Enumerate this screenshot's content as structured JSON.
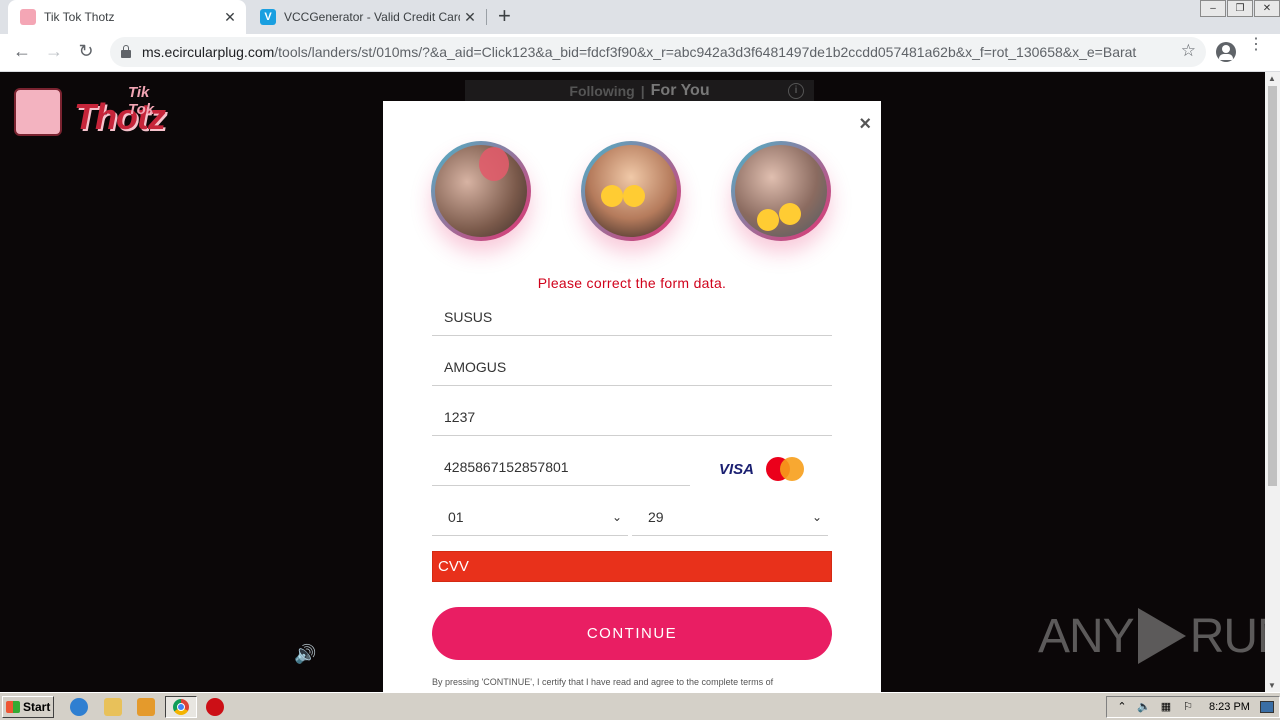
{
  "browser": {
    "tabs": [
      {
        "title": "Tik Tok Thotz",
        "favicon": "tiktokthotz-favicon",
        "active": true
      },
      {
        "title": "VCCGenerator - Valid Credit Card Ge",
        "favicon": "vcc-favicon",
        "active": false
      }
    ],
    "favicon_letter_vcc": "V",
    "new_tab_label": "+",
    "close_glyph": "✕",
    "window_controls": [
      "–",
      "❐",
      "✕"
    ],
    "url_host": "ms.ecircularplug.com",
    "url_path": "/tools/landers/st/010ms/?&a_aid=Click123&a_bid=fdcf3f90&x_r=abc942a3d3f6481497de1b2ccdd057481a62b&x_f=rot_130658&x_e=Barat",
    "nav": {
      "back": "←",
      "forward": "→",
      "reload": "↻",
      "star": "☆",
      "menu": "⋮"
    }
  },
  "page": {
    "logo_small": "Tik Tok",
    "logo_big": "Thotz",
    "feed_tabs": {
      "following": "Following",
      "separator": "|",
      "for_you": "For You",
      "info": "i"
    },
    "speaker_icon": "🔊",
    "watermark": {
      "left": "ANY",
      "right": "RUN"
    }
  },
  "modal": {
    "close": "×",
    "error_message": "Please correct the form data.",
    "fields": {
      "first_name": "SUSUS",
      "last_name": "AMOGUS",
      "zip": "1237",
      "card_number": "4285867152857801",
      "exp_month": "01",
      "exp_year": "29",
      "cvv_placeholder": "CVV"
    },
    "card_brands": {
      "visa": "VISA",
      "mastercard": "mastercard"
    },
    "chevron": "⌄",
    "continue_label": "CONTINUE",
    "terms": "By pressing 'CONTINUE', I certify that I have read and agree to the complete terms of"
  },
  "taskbar": {
    "start_label": "Start",
    "clock": "8:23 PM",
    "tray_icons": [
      "⌃",
      "🔈",
      "▦",
      "⚐"
    ]
  },
  "colors": {
    "accent_pink": "#e91e63",
    "error_red": "#d0021b",
    "cvv_error_bg": "#e8311b"
  }
}
